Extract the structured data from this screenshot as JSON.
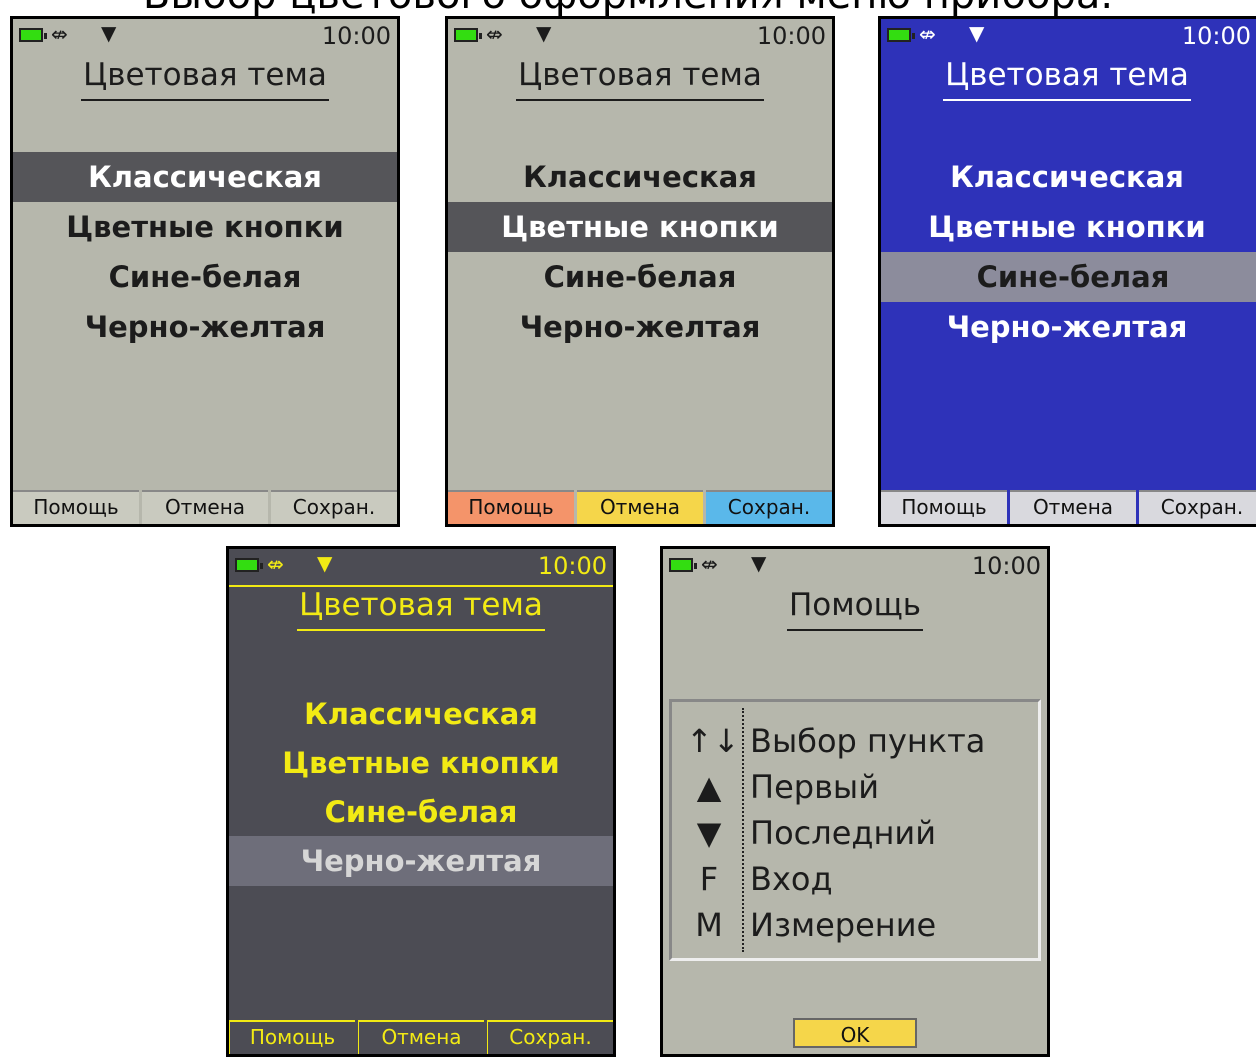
{
  "caption": "Выбор цветового оформления меню прибора.",
  "status": {
    "time": "10:00",
    "usb_icon": "usb-icon",
    "arrow_icon": "signal-arrow-icon",
    "battery_icon": "battery-icon"
  },
  "theme_screen": {
    "title": "Цветовая тема",
    "items": [
      "Классическая",
      "Цветные кнопки",
      "Сине-белая",
      "Черно-желтая"
    ],
    "buttons": [
      "Помощь",
      "Отмена",
      "Сохран."
    ],
    "colored_button_colors": [
      "#f4946a",
      "#f5d64a",
      "#5ab8ea"
    ]
  },
  "screens": [
    {
      "theme": "classic",
      "selected_index": 0
    },
    {
      "theme": "color-buttons",
      "selected_index": 1
    },
    {
      "theme": "blue-white",
      "selected_index": 2
    },
    {
      "theme": "black-yellow",
      "selected_index": 3
    }
  ],
  "help_screen": {
    "title": "Помощь",
    "rows": [
      {
        "key": "↑↓",
        "text": "Выбор пункта"
      },
      {
        "key": "▲",
        "text": "Первый"
      },
      {
        "key": "▼",
        "text": "Последний"
      },
      {
        "key": "F",
        "text": "Вход"
      },
      {
        "key": "M",
        "text": "Измерение"
      }
    ],
    "ok_label": "OK"
  }
}
